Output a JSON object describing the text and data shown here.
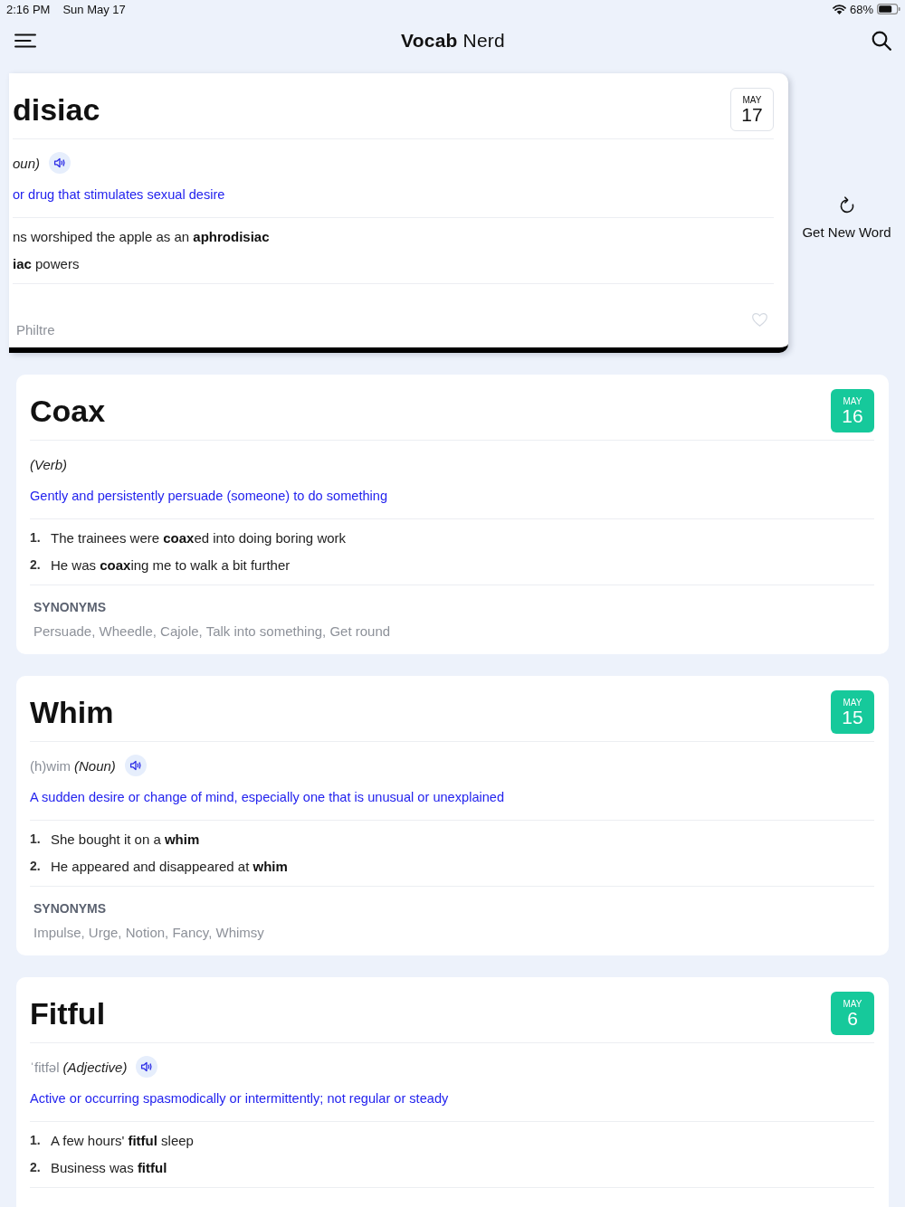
{
  "status_bar": {
    "time": "2:16 PM",
    "date": "Sun May 17",
    "battery": "68%"
  },
  "nav": {
    "title": "**Vocab** Nerd"
  },
  "today": {
    "word": "disiac",
    "part_of_speech": "oun)",
    "audio": true,
    "definition": "or drug that stimulates sexual desire",
    "examples": [
      {
        "text": "ns worshiped the apple as an **aphrodisiac**"
      },
      {
        "text": "**iac** powers"
      }
    ],
    "synonyms": "Philtre",
    "favorited": false,
    "date": {
      "month": "MAY",
      "day": "17"
    }
  },
  "get_new_word": {
    "label": "Get New Word"
  },
  "history": [
    {
      "word": "Coax",
      "part_of_speech": "(Verb)",
      "audio": false,
      "definition": "Gently and persistently persuade (someone) to do something",
      "examples": [
        {
          "number": "1.",
          "text": "The trainees were **coax**ed into doing boring work"
        },
        {
          "number": "2.",
          "text": "He was **coax**ing me to walk a bit further"
        }
      ],
      "synonyms_label": "SYNONYMS",
      "synonyms": "Persuade, Wheedle, Cajole, Talk into something, Get round",
      "date": {
        "month": "MAY",
        "day": "16"
      }
    },
    {
      "word": "Whim",
      "pronunciation": "(h)wim",
      "part_of_speech": "(Noun)",
      "audio": true,
      "definition": "A sudden desire or change of mind, especially one that is unusual or unexplained",
      "examples": [
        {
          "number": "1.",
          "text": "She bought it on a **whim**"
        },
        {
          "number": "2.",
          "text": "He appeared and disappeared at **whim**"
        }
      ],
      "synonyms_label": "SYNONYMS",
      "synonyms": "Impulse, Urge, Notion, Fancy, Whimsy",
      "date": {
        "month": "MAY",
        "day": "15"
      }
    },
    {
      "word": "Fitful",
      "pronunciation": "ˈfitfəl",
      "part_of_speech": "(Adjective)",
      "audio": true,
      "definition": "Active or occurring spasmodically or intermittently; not regular or steady",
      "examples": [
        {
          "number": "1.",
          "text": "A few hours' **fitful** sleep"
        },
        {
          "number": "2.",
          "text": "Business was **fitful**"
        }
      ],
      "date": {
        "month": "MAY",
        "day": "6"
      }
    }
  ]
}
